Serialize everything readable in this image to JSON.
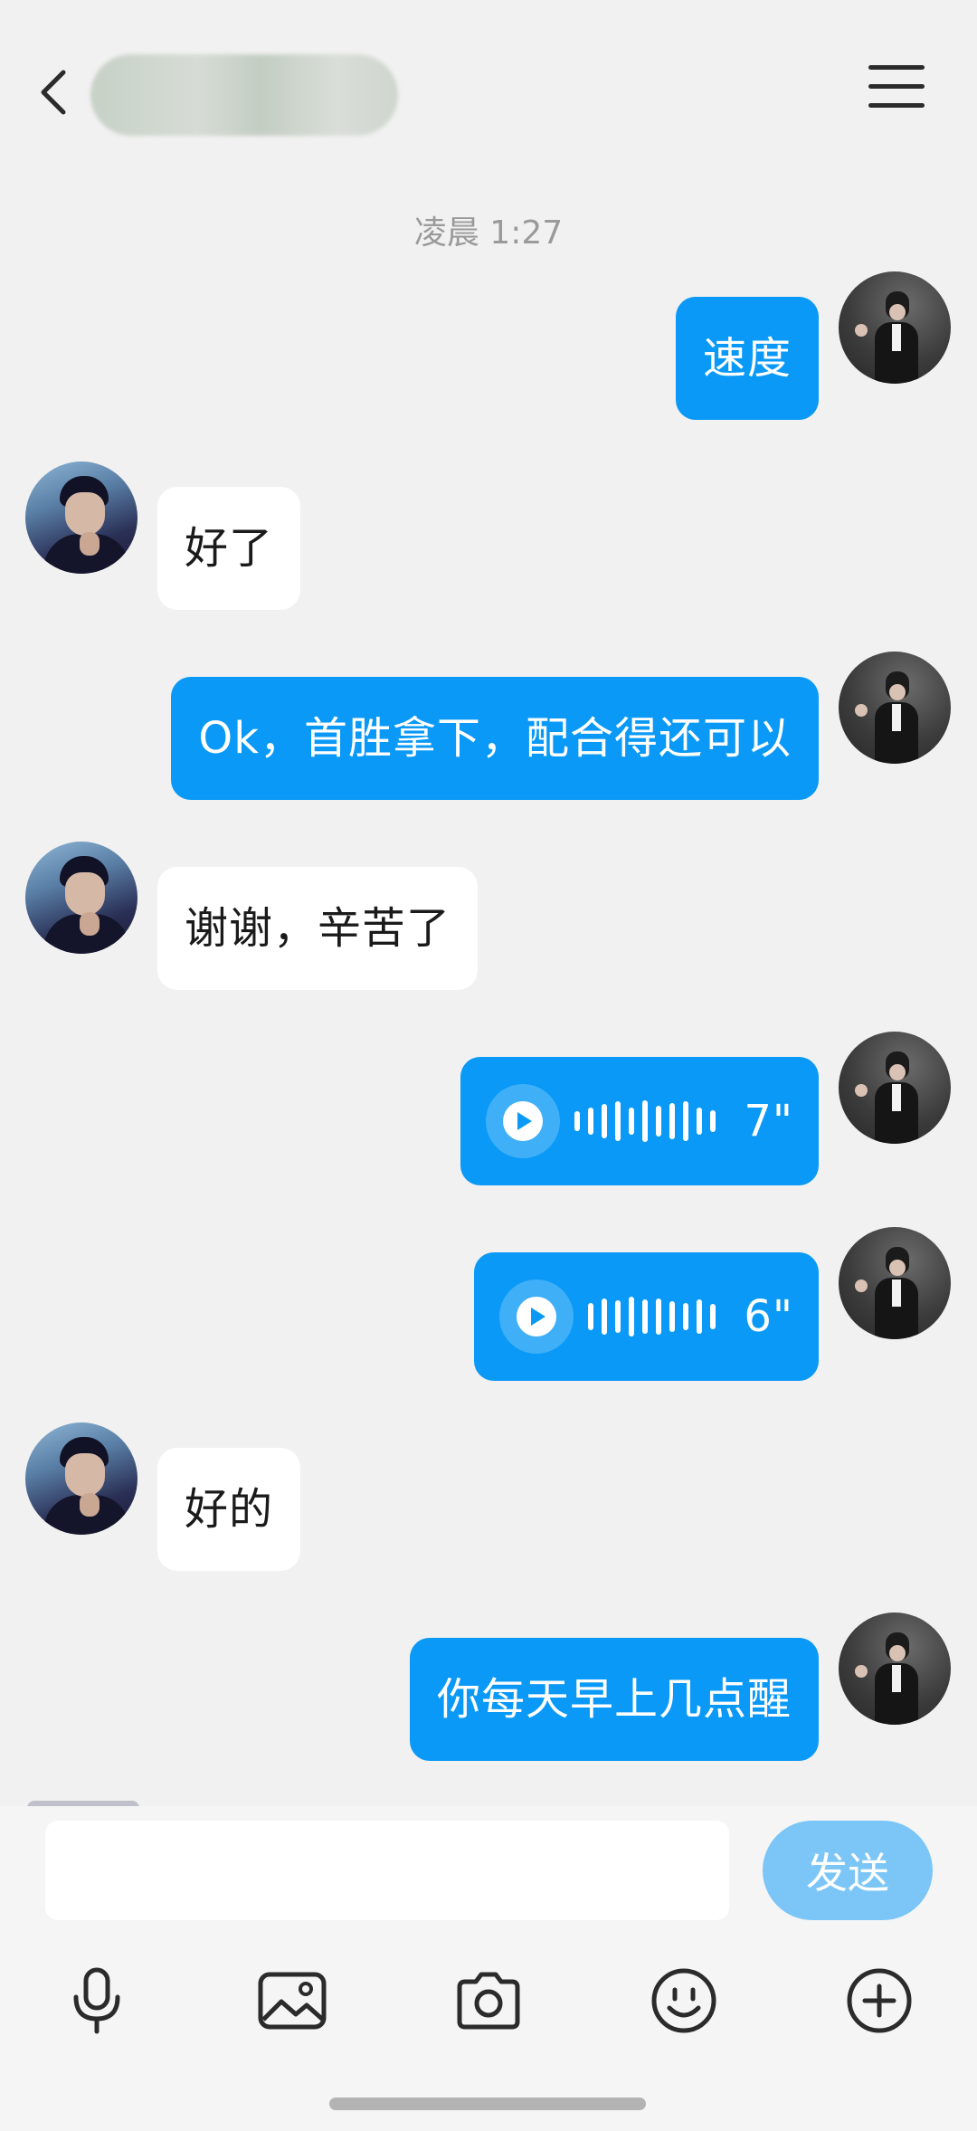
{
  "header": {
    "contact_name": "",
    "menu_icon": "hamburger-menu-icon",
    "back_icon": "chevron-left-icon"
  },
  "chat": {
    "timestamp": "凌晨 1:27",
    "messages": [
      {
        "sender": "me",
        "type": "text",
        "text": "速度"
      },
      {
        "sender": "other",
        "type": "text",
        "text": "好了"
      },
      {
        "sender": "me",
        "type": "text",
        "text": "Ok，首胜拿下，配合得还可以"
      },
      {
        "sender": "other",
        "type": "text",
        "text": "谢谢，辛苦了"
      },
      {
        "sender": "me",
        "type": "voice",
        "duration": "7\""
      },
      {
        "sender": "me",
        "type": "voice",
        "duration": "6\""
      },
      {
        "sender": "other",
        "type": "text",
        "text": "好的"
      },
      {
        "sender": "me",
        "type": "text",
        "text": "你每天早上几点醒"
      }
    ]
  },
  "composer": {
    "input_value": "",
    "send_label": "发送",
    "tools": [
      "microphone-icon",
      "image-icon",
      "camera-icon",
      "emoji-icon",
      "plus-icon"
    ]
  },
  "colors": {
    "accent": "#0a99f6",
    "send_disabled": "#7cc6f7",
    "background": "#f1f1f1"
  }
}
